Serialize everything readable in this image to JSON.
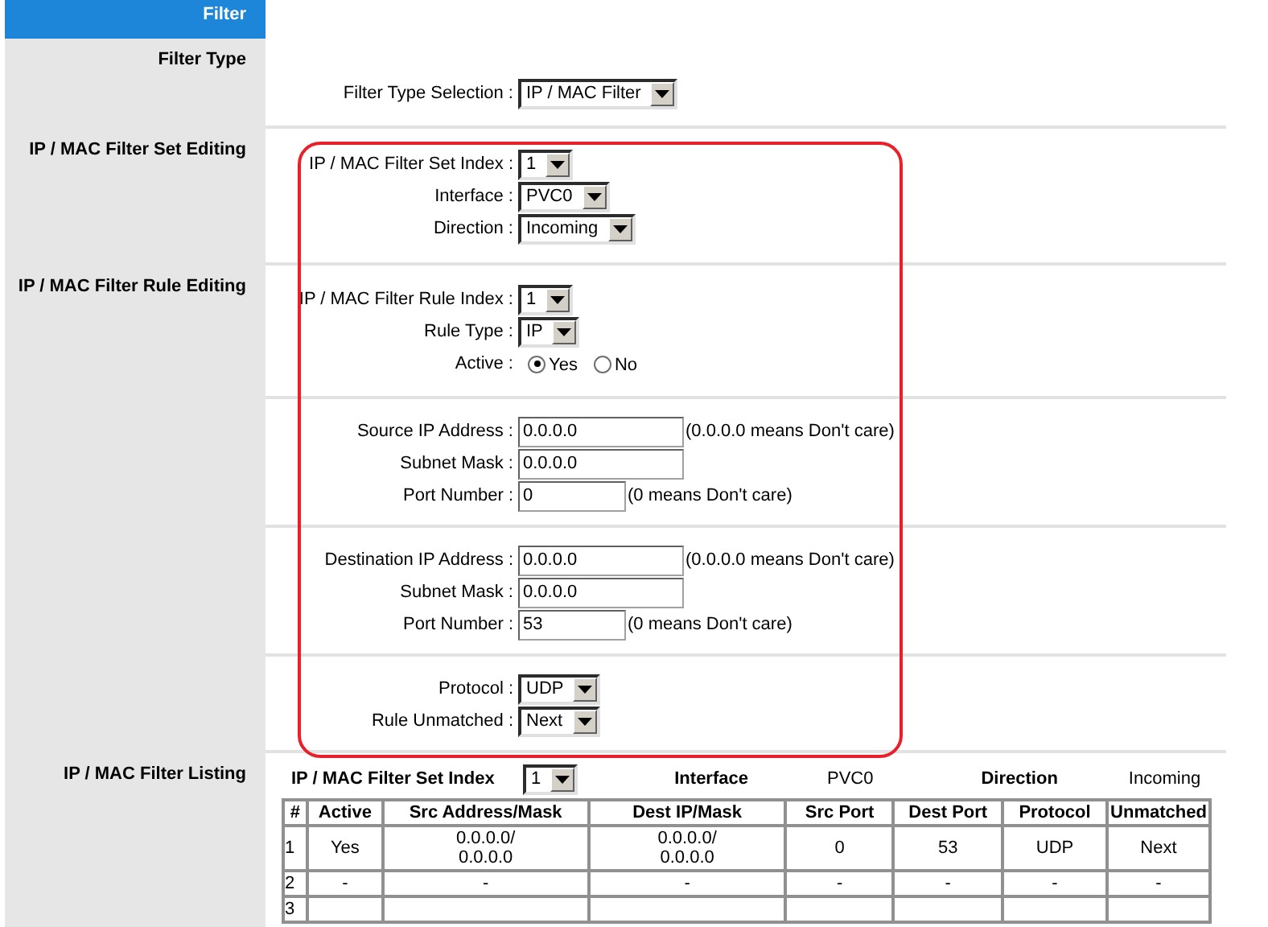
{
  "sidebar_header": "Filter",
  "sections": [
    {
      "heading": "Filter Type",
      "rows": [
        {
          "kind": "select",
          "label": "Filter Type Selection :",
          "value": "IP / MAC Filter"
        }
      ]
    },
    {
      "heading": "IP / MAC Filter Set Editing",
      "rows": [
        {
          "kind": "select",
          "label": "IP / MAC Filter Set Index :",
          "value": "1"
        },
        {
          "kind": "select",
          "label": "Interface :",
          "value": "PVC0"
        },
        {
          "kind": "select",
          "label": "Direction :",
          "value": "Incoming"
        }
      ]
    },
    {
      "heading": "IP / MAC Filter Rule Editing",
      "rows": [
        {
          "kind": "select",
          "label": "IP / MAC Filter Rule Index :",
          "value": "1"
        },
        {
          "kind": "select",
          "label": "Rule Type :",
          "value": "IP"
        },
        {
          "kind": "radio",
          "label": "Active :",
          "options": [
            {
              "label": "Yes",
              "selected": true
            },
            {
              "label": "No",
              "selected": false
            }
          ]
        }
      ]
    },
    {
      "rows": [
        {
          "kind": "address",
          "label": "Source IP Address :",
          "value": "0.0.0.0",
          "hint": "(0.0.0.0 means Don't care)"
        },
        {
          "kind": "address",
          "label": "Subnet Mask :",
          "value": "0.0.0.0"
        },
        {
          "kind": "port",
          "label": "Port Number :",
          "value": "0",
          "hint": "(0 means Don't care)"
        }
      ]
    },
    {
      "rows": [
        {
          "kind": "address",
          "label": "Destination IP Address :",
          "value": "0.0.0.0",
          "hint": "(0.0.0.0 means Don't care)"
        },
        {
          "kind": "address",
          "label": "Subnet Mask :",
          "value": "0.0.0.0"
        },
        {
          "kind": "port",
          "label": "Port Number :",
          "value": "53",
          "hint": "(0 means Don't care)"
        }
      ]
    },
    {
      "rows": [
        {
          "kind": "select",
          "label": "Protocol :",
          "value": "UDP"
        },
        {
          "kind": "select",
          "label": "Rule Unmatched :",
          "value": "Next"
        }
      ]
    }
  ],
  "listing": {
    "heading": "IP / MAC Filter Listing",
    "set_index_label": "IP / MAC Filter Set Index",
    "set_index": "1",
    "interface_label": "Interface",
    "interface": "PVC0",
    "direction_label": "Direction",
    "direction": "Incoming",
    "columns": [
      "#",
      "Active",
      "Src Address/Mask",
      "Dest IP/Mask",
      "Src Port",
      "Dest Port",
      "Protocol",
      "Unmatched"
    ],
    "rows": [
      [
        "1",
        "Yes",
        "0.0.0.0/\n0.0.0.0",
        "0.0.0.0/\n0.0.0.0",
        "0",
        "53",
        "UDP",
        "Next"
      ],
      [
        "2",
        "-",
        "-",
        "-",
        "-",
        "-",
        "-",
        "-"
      ],
      [
        "3"
      ]
    ]
  }
}
